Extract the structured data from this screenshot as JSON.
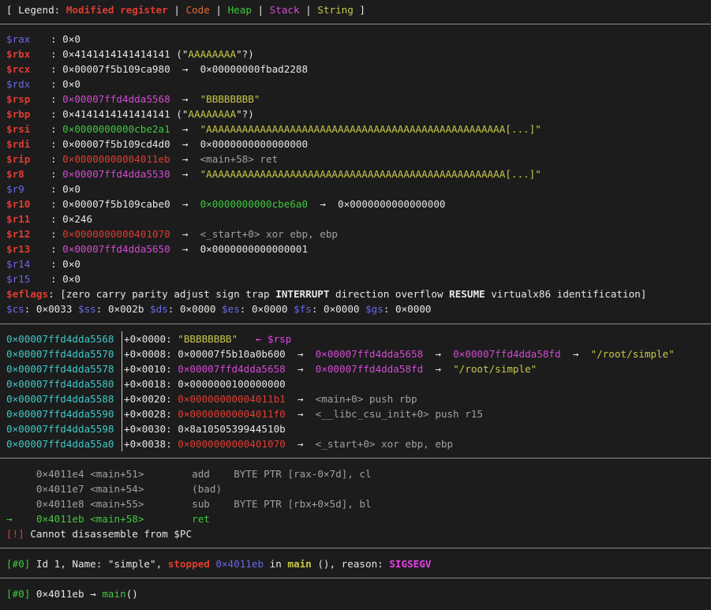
{
  "legend": {
    "prefix": "[ Legend: ",
    "modified": "Modified register",
    "code": "Code",
    "heap": "Heap",
    "stack": "Stack",
    "string": "String",
    "suffix": " ]",
    "bar": " | "
  },
  "arrow": "→",
  "colon": ": ",
  "registers": [
    {
      "name": "$rax",
      "value": "0×0"
    },
    {
      "name": "$rbx",
      "value": "0×4141414141414141",
      "extra": " (\"",
      "str": "AAAAAAAA",
      "tail": "\"?)"
    },
    {
      "name": "$rcx",
      "value": "0×00007f5b109ca980",
      "deref": "0×00000000fbad2288"
    },
    {
      "name": "$rdx",
      "value": "0×0"
    },
    {
      "name": "$rsp",
      "value": "0×00007ffd4dda5568",
      "deref": "\"BBBBBBBB\""
    },
    {
      "name": "$rbp",
      "value": "0×4141414141414141",
      "extra": " (\"",
      "str": "AAAAAAAA",
      "tail": "\"?)"
    },
    {
      "name": "$rsi",
      "value": "0×0000000000cbe2a1",
      "deref": "\"AAAAAAAAAAAAAAAAAAAAAAAAAAAAAAAAAAAAAAAAAAAAAAAAAA[...]\""
    },
    {
      "name": "$rdi",
      "value": "0×00007f5b109cd4d0",
      "deref": "0×0000000000000000"
    },
    {
      "name": "$rip",
      "value": "0×00000000004011eb",
      "deref": "<main+58> ret"
    },
    {
      "name": "$r8",
      "value": "0×00007ffd4dda5530",
      "deref": "\"AAAAAAAAAAAAAAAAAAAAAAAAAAAAAAAAAAAAAAAAAAAAAAAAAA[...]\""
    },
    {
      "name": "$r9",
      "value": "0×0"
    },
    {
      "name": "$r10",
      "value": "0×00007f5b109cabe0",
      "deref": "0×0000000000cbe6a0",
      "deref2": "0×0000000000000000"
    },
    {
      "name": "$r11",
      "value": "0×246"
    },
    {
      "name": "$r12",
      "value": "0×0000000000401070",
      "deref": "<_start+0> xor ebp, ebp"
    },
    {
      "name": "$r13",
      "value": "0×00007ffd4dda5650",
      "deref": "0×0000000000000001"
    },
    {
      "name": "$r14",
      "value": "0×0"
    },
    {
      "name": "$r15",
      "value": "0×0"
    }
  ],
  "eflags": {
    "name": "$eflags",
    "p1": "[zero carry parity adjust sign trap ",
    "b1": "INTERRUPT",
    "p2": " direction overflow ",
    "b2": "RESUME",
    "p3": " virtualx86 identification]"
  },
  "segments": [
    {
      "name": "$cs",
      "value": "0×0033"
    },
    {
      "name": "$ss",
      "value": "0×002b"
    },
    {
      "name": "$ds",
      "value": "0×0000"
    },
    {
      "name": "$es",
      "value": "0×0000"
    },
    {
      "name": "$fs",
      "value": "0×0000"
    },
    {
      "name": "$gs",
      "value": "0×0000"
    }
  ],
  "stack": [
    {
      "addr": "0×00007ffd4dda5568",
      "off": "+0×0000: ",
      "v1": "\"BBBBBBBB\"",
      "marker": "← $rsp"
    },
    {
      "addr": "0×00007ffd4dda5570",
      "off": "+0×0008: ",
      "v1": "0×00007f5b10a0b600",
      "v2": "0×00007ffd4dda5658",
      "v3": "0×00007ffd4dda58fd",
      "v4": "\"/root/simple\""
    },
    {
      "addr": "0×00007ffd4dda5578",
      "off": "+0×0010: ",
      "v1": "0×00007ffd4dda5658",
      "v2": "0×00007ffd4dda58fd",
      "v3": "\"/root/simple\""
    },
    {
      "addr": "0×00007ffd4dda5580",
      "off": "+0×0018: ",
      "v1": "0×0000000100000000"
    },
    {
      "addr": "0×00007ffd4dda5588",
      "off": "+0×0020: ",
      "v1": "0×00000000004011b1",
      "v2": "<main+0> push rbp"
    },
    {
      "addr": "0×00007ffd4dda5590",
      "off": "+0×0028: ",
      "v1": "0×00000000004011f0",
      "v2": "<__libc_csu_init+0> push r15"
    },
    {
      "addr": "0×00007ffd4dda5598",
      "off": "+0×0030: ",
      "v1": "0×8a1050539944510b"
    },
    {
      "addr": "0×00007ffd4dda55a0",
      "off": "+0×0038: ",
      "v1": "0×0000000000401070",
      "v2": "<_start+0> xor ebp, ebp"
    }
  ],
  "code": [
    {
      "addr": "0×4011e4",
      "sym": "<main+51>",
      "mn": "add",
      "ops": "BYTE PTR [rax-0×7d], cl"
    },
    {
      "addr": "0×4011e7",
      "sym": "<main+54>",
      "mn": "(bad)",
      "ops": ""
    },
    {
      "addr": "0×4011e8",
      "sym": "<main+55>",
      "mn": "sub",
      "ops": "BYTE PTR [rbx+0×5d], bl"
    },
    {
      "addr": "0×4011eb",
      "sym": "<main+58>",
      "mn": "ret",
      "ops": "",
      "current": true,
      "marker": "→"
    }
  ],
  "error": {
    "tag": "[!]",
    "text": " Cannot disassemble from $PC"
  },
  "thread": {
    "tag": "[#0]",
    "p1": " Id 1, Name: \"simple\", ",
    "state": "stopped",
    "addr": " 0×4011eb",
    "p2": " in ",
    "func": "main",
    "p3": " (), reason: ",
    "reason": "SIGSEGV"
  },
  "trace": {
    "tag": "[#0]",
    "p1": " 0×4011eb → ",
    "func": "main",
    "p2": "()"
  }
}
